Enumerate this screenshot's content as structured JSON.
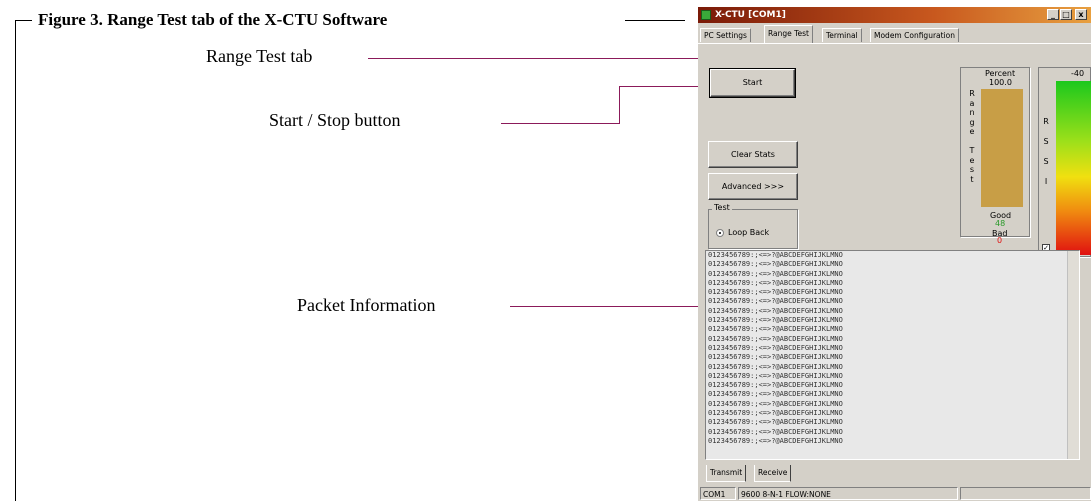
{
  "figure": {
    "caption": "Figure 3.  Range Test tab of the X-CTU Software"
  },
  "callouts": {
    "range_test_tab": "Range Test tab",
    "start_stop_button": "Start / Stop button",
    "packet_information": "Packet Information"
  },
  "window": {
    "title": "X-CTU  [COM1]",
    "controls": [
      "_",
      "□",
      "x"
    ],
    "tabs": [
      "PC Settings",
      "Range Test",
      "Terminal",
      "Modem Configuration"
    ],
    "active_tab": "Range Test"
  },
  "buttons": {
    "start": "Start",
    "clear_stats": "Clear Stats",
    "advanced": "Advanced >>>"
  },
  "test_group": {
    "label": "Test",
    "option": "Loop Back"
  },
  "range_panel": {
    "vertical_label": "R\na\nn\ng\ne\n\nT\ne\ns\nt",
    "percent_label": "Percent",
    "percent_value": "100.0",
    "percent_fill": 1.0,
    "good_label": "Good",
    "good_value": "48",
    "bad_label": "Bad",
    "bad_value": "0"
  },
  "rssi_panel": {
    "vertical_label": "R\n\nS\n\nS\n\nI",
    "value": "-40",
    "checkbox": "✓"
  },
  "packet_lines": [
    "0123456789:;<=>?@ABCDEFGHIJKLMNO",
    "0123456789:;<=>?@ABCDEFGHIJKLMNO",
    "0123456789:;<=>?@ABCDEFGHIJKLMNO",
    "0123456789:;<=>?@ABCDEFGHIJKLMNO",
    "0123456789:;<=>?@ABCDEFGHIJKLMNO",
    "0123456789:;<=>?@ABCDEFGHIJKLMNO",
    "0123456789:;<=>?@ABCDEFGHIJKLMNO",
    "0123456789:;<=>?@ABCDEFGHIJKLMNO",
    "0123456789:;<=>?@ABCDEFGHIJKLMNO",
    "0123456789:;<=>?@ABCDEFGHIJKLMNO",
    "0123456789:;<=>?@ABCDEFGHIJKLMNO",
    "0123456789:;<=>?@ABCDEFGHIJKLMNO",
    "0123456789:;<=>?@ABCDEFGHIJKLMNO",
    "0123456789:;<=>?@ABCDEFGHIJKLMNO",
    "0123456789:;<=>?@ABCDEFGHIJKLMNO",
    "0123456789:;<=>?@ABCDEFGHIJKLMNO",
    "0123456789:;<=>?@ABCDEFGHIJKLMNO",
    "0123456789:;<=>?@ABCDEFGHIJKLMNO",
    "0123456789:;<=>?@ABCDEFGHIJKLMNO",
    "0123456789:;<=>?@ABCDEFGHIJKLMNO",
    "0123456789:;<=>?@ABCDEFGHIJKLMNO"
  ],
  "bottom_tabs": {
    "transmit": "Transmit",
    "receive": "Receive"
  },
  "statusbar": {
    "port": "COM1",
    "settings": "9600 8-N-1  FLOW:NONE"
  },
  "colors": {
    "callout_line": "#8b1a5a",
    "title_bar": "#c8581e",
    "good_value": "#2a9a2a",
    "bad_value": "#e01010",
    "percent_bar": "#c89e46"
  }
}
